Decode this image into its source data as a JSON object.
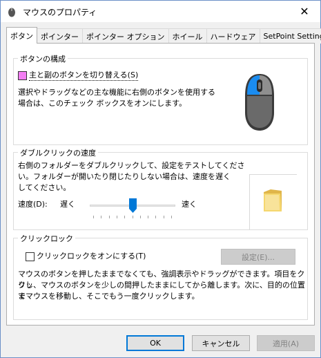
{
  "window": {
    "title": "マウスのプロパティ",
    "close_glyph": "✕"
  },
  "tabs": [
    {
      "label": "ボタン",
      "active": true
    },
    {
      "label": "ポインター"
    },
    {
      "label": "ポインター オプション"
    },
    {
      "label": "ホイール"
    },
    {
      "label": "ハードウェア"
    },
    {
      "label": "SetPoint Settings"
    }
  ],
  "button_config": {
    "group_label": "ボタンの構成",
    "switch_checkbox_label": "主と副のボタンを切り替える(S)",
    "description_line1": "選択やドラッグなどの主な機能に右側のボタンを使用する",
    "description_line2": "場合は、このチェック ボックスをオンにします。",
    "checkbox_color": "#f37ef3",
    "mouse_accent": "#1a8cf0"
  },
  "double_click": {
    "group_label": "ダブルクリックの速度",
    "description_line1": "右側のフォルダーをダブルクリックして、設定をテストしてくださ",
    "description_line2": "い。フォルダーが開いたり閉じたりしない場合は、速度を遅く",
    "description_line3": "してください。",
    "speed_label": "速度(D):",
    "slow_label": "遅く",
    "fast_label": "速く",
    "speed_value": 0.5,
    "slider_color": "#0078d7",
    "folder_color": "#f5d76e"
  },
  "click_lock": {
    "group_label": "クリックロック",
    "checkbox_label": "クリックロックをオンにする(T)",
    "settings_button": "設定(E)...",
    "description_line1": "マウスのボタンを押したままでなくても、強調表示やドラッグができます。項目をクリッ",
    "description_line2": "クし、マウスのボタンを少しの間押したままにしてから離します。次に、目的の位置ま",
    "description_line3": "でマウスを移動し、そこでもう一度クリックします。"
  },
  "footer": {
    "ok_label": "OK",
    "cancel_label": "キャンセル",
    "apply_label": "適用(A)"
  }
}
